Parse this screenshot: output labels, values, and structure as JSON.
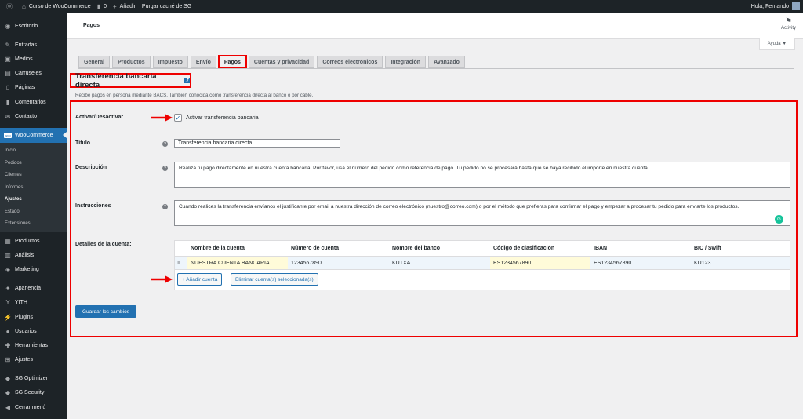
{
  "adminbar": {
    "site_name": "Curso de WooCommerce",
    "comments_count": "0",
    "add_label": "Añadir",
    "purge_label": "Purgar caché de SG",
    "greeting": "Hola, Fernando"
  },
  "sidebar": {
    "items_top": [
      {
        "label": "Escritorio",
        "icon": "dashboard-icon"
      },
      {
        "label": "Entradas",
        "icon": "pin-icon"
      },
      {
        "label": "Medios",
        "icon": "media-icon"
      },
      {
        "label": "Carruseles",
        "icon": "carousel-icon"
      },
      {
        "label": "Páginas",
        "icon": "pages-icon"
      },
      {
        "label": "Comentarios",
        "icon": "comments-icon"
      },
      {
        "label": "Contacto",
        "icon": "mail-icon"
      }
    ],
    "woocommerce_label": "WooCommerce",
    "woo_badge": "woo",
    "submenu": [
      "Inicio",
      "Pedidos",
      "Clientes",
      "Informes",
      "Ajustes",
      "Estado",
      "Extensiones"
    ],
    "items_bottom": [
      {
        "label": "Productos",
        "icon": "products-icon"
      },
      {
        "label": "Análisis",
        "icon": "analytics-icon"
      },
      {
        "label": "Marketing",
        "icon": "marketing-icon"
      },
      {
        "label": "Apariencia",
        "icon": "appearance-icon"
      },
      {
        "label": "YITH",
        "icon": "yith-icon"
      },
      {
        "label": "Plugins",
        "icon": "plugins-icon"
      },
      {
        "label": "Usuarios",
        "icon": "users-icon"
      },
      {
        "label": "Herramientas",
        "icon": "tools-icon"
      },
      {
        "label": "Ajustes",
        "icon": "settings-icon"
      },
      {
        "label": "SG Optimizer",
        "icon": "sg-optimizer-icon"
      },
      {
        "label": "SG Security",
        "icon": "sg-security-icon"
      },
      {
        "label": "Cerrar menú",
        "icon": "collapse-icon"
      }
    ]
  },
  "header": {
    "title": "Pagos",
    "activity_label": "Activity",
    "help_label": "Ayuda ▼"
  },
  "tabs": [
    "General",
    "Productos",
    "Impuesto",
    "Envío",
    "Pagos",
    "Cuentas y privacidad",
    "Correos electrónicos",
    "Integración",
    "Avanzado"
  ],
  "section": {
    "title": "Transferencia bancaria directa",
    "description": "Recibe pagos en persona mediante BACS. También conocida como transferencia directa al banco o por cable."
  },
  "form": {
    "enable_label": "Activar/Desactivar",
    "enable_checkbox_label": "Activar transferencia bancaria",
    "enable_checked": true,
    "title_label": "Título",
    "title_value": "Transferencia bancaria directa",
    "description_label": "Descripción",
    "description_value": "Realiza tu pago directamente en nuestra cuenta bancaria. Por favor, usa el número del pedido como referencia de pago. Tu pedido no se procesará hasta que se haya recibido el importe en nuestra cuenta.",
    "instructions_label": "Instrucciones",
    "instructions_value": "Cuando realices la transferencia envíanos el justificante por email a nuestra dirección de correo electrónico (nuestro@correo.com) o por el método que prefieras para confirmar el pago y empezar a procesar tu pedido para enviarte los productos.",
    "accounts_label": "Detalles de la cuenta:"
  },
  "accounts_table": {
    "headers": [
      "Nombre de la cuenta",
      "Número de cuenta",
      "Nombre del banco",
      "Código de clasificación",
      "IBAN",
      "BIC / Swift"
    ],
    "rows": [
      [
        "NUESTRA CUENTA BANCARIA",
        "1234567890",
        "KUTXA",
        "ES1234567890",
        "ES1234567890",
        "KU123"
      ]
    ],
    "add_button": "+ Añadir cuenta",
    "remove_button": "Eliminar cuenta(s) seleccionada(s)"
  },
  "save_button": "Guardar los cambios",
  "colors": {
    "admin_dark": "#1d2327",
    "accent": "#2271b1",
    "highlight_red": "#e00"
  }
}
